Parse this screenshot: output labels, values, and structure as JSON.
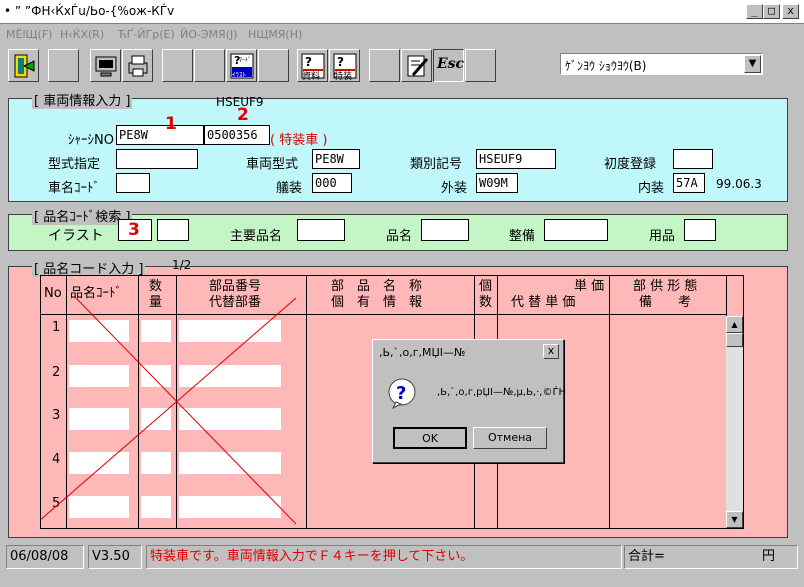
{
  "window": {
    "title": "• ” ”ФН‹ЌхЃu/Ьо-{%ож-КЃv",
    "min": "_",
    "max": "□",
    "close": "x"
  },
  "menu": [
    "MЁlЩ(F)",
    "Н‹ЌХ(R)",
    "ЋҐ‐ЙГр(E)",
    "ЙО-ЭМЯ(J)",
    "НЩМЯ(H)"
  ],
  "combo": {
    "value": "ｹﾞﾝﾖｳ ｼｮｳﾖｳ(B)"
  },
  "toolbar": {
    "label_mapillust_top": "ﾏｰﾄﾞ",
    "label_mapillust": "ｲﾗｽﾄ",
    "label_shiryo": "資料",
    "label_tokusou": "特装",
    "label_esc": "Esc"
  },
  "vehicle": {
    "legend": "[ 車両情報入力 ]",
    "header_code": "HSEUF9",
    "chassis_label": "ｼｬｰｼNO",
    "chassis_1": "PE8W",
    "chassis_2": "0500356",
    "special_note": "( 特装車 )",
    "marker_1": "1",
    "marker_2": "2",
    "model_label": "型式指定",
    "model_value": "",
    "car_type_label": "車両型式",
    "car_type_value": "PE8W",
    "class_label": "類別記号",
    "class_value": "HSEUF9",
    "first_reg_label": "初度登録",
    "first_reg_value": "",
    "name_code_label": "車名ｺｰﾄﾞ",
    "name_code_value": "",
    "trim_label": "艤装",
    "trim_value": "000",
    "exterior_label": "外装",
    "exterior_value": "W09M",
    "interior_label": "内装",
    "interior_value": "57A",
    "date_value": "99.06.3"
  },
  "partsearch": {
    "legend": "[ 品名ｺｰﾄﾞ検索 ]",
    "illust_label": "イラスト",
    "marker_3": "3",
    "major_label": "主要品名",
    "name_label": "品名",
    "maint_label": "整備",
    "goods_label": "用品"
  },
  "partinput": {
    "legend": "[ 品名コード入力 ]",
    "page": "1/2",
    "headers": {
      "no": "No",
      "code": "品名ｺｰﾄﾞ",
      "qty_1": "数",
      "qty_2": "量",
      "partnum_1": "部品番号",
      "partnum_2": "代替部番",
      "name_1": "部　品　名　称",
      "name_2": "個　有　情　報",
      "count_1": "個",
      "count_2": "数",
      "price_1": "単 価",
      "price_2": "代 替 単 価",
      "form_1": "部 供 形 態",
      "form_2": "備　　考"
    },
    "rows": [
      "1",
      "2",
      "3",
      "4",
      "5"
    ]
  },
  "dialog": {
    "title": ",Ь,`,о,г,МЏІ—№",
    "close": "x",
    "message": ",Ь,`,о,г,рЏІ—№,µ,Ь,·,©ЃН",
    "ok": "OK",
    "cancel": "Отмена"
  },
  "status": {
    "date": "06/08/08",
    "version": "V3.50",
    "message": "特装車です。車両情報入力でＦ４キーを押して下さい。",
    "total_label": "合計=",
    "currency": "円"
  },
  "colors": {
    "cyan_panel": "#bff7fb",
    "green_panel": "#c4f5c4",
    "pink_panel": "#ffb8b8",
    "red_text": "#e00000"
  }
}
